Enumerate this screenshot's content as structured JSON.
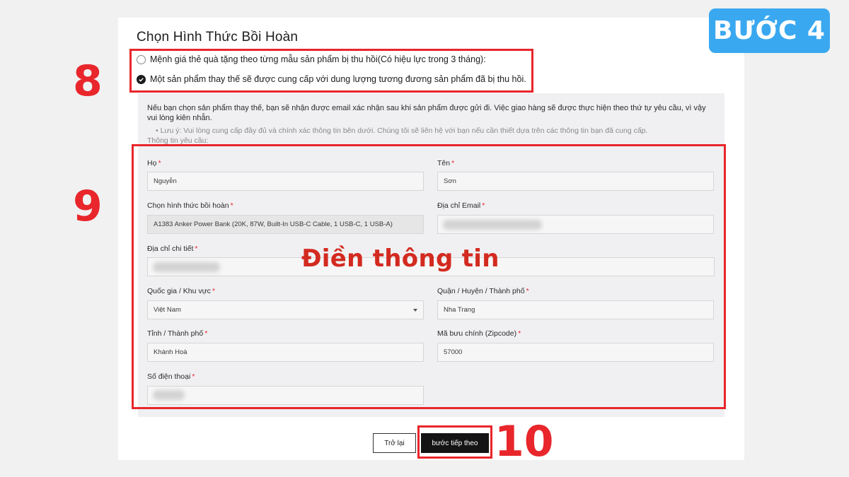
{
  "step_badge": "BƯỚC 4",
  "annotations": {
    "num8": "8",
    "num9": "9",
    "num10": "10",
    "overlay": "Điền thông tin"
  },
  "section_title": "Chọn Hình Thức Bồi Hoàn",
  "options": [
    {
      "label": "Mệnh giá thẻ quà tặng theo từng mẫu sản phẩm bị thu hồi(Có hiệu lực trong 3 tháng):",
      "selected": false
    },
    {
      "label": "Một sản phẩm thay thế sẽ được cung cấp với dung lượng tương đương sản phẩm đã bị thu hồi.",
      "selected": true
    }
  ],
  "info": {
    "line1": "Nếu bạn chọn sản phẩm thay thế, bạn sẽ nhận được email xác nhận sau khi sản phẩm được gửi đi. Việc giao hàng sẽ được thực hiện theo thứ tự yêu cầu, vì vậy",
    "line2": "vui lòng kiên nhẫn.",
    "note": "•  Lưu ý: Vui lòng cung cấp đầy đủ và chính xác thông tin bên dưới. Chúng tôi sẽ liên hệ với bạn nếu cần thiết dựa trên các thông tin bạn đã cung cấp.",
    "subheading": "Thông tin yêu cầu:"
  },
  "form": {
    "ho": {
      "label": "Họ",
      "value": "Nguyễn"
    },
    "ten": {
      "label": "Tên",
      "value": "Sơn"
    },
    "hinh_thuc": {
      "label": "Chọn hình thức bồi hoàn",
      "value": "A1383 Anker Power Bank (20K, 87W, Built-In USB-C Cable, 1 USB-C, 1 USB-A)"
    },
    "email": {
      "label": "Địa chỉ Email",
      "value": ""
    },
    "dia_chi": {
      "label": "Địa chỉ chi tiết",
      "value": ""
    },
    "quoc_gia": {
      "label": "Quốc gia / Khu vực",
      "value": "Việt Nam"
    },
    "quan": {
      "label": "Quận / Huyện / Thành phố",
      "value": "Nha Trang"
    },
    "tinh": {
      "label": "Tỉnh / Thành phố",
      "value": "Khánh Hoà"
    },
    "zip": {
      "label": "Mã bưu chính (Zipcode)",
      "value": "57000"
    },
    "phone": {
      "label": "Số điện thoại",
      "value": ""
    }
  },
  "buttons": {
    "back": "Trở lại",
    "next": "bước tiếp theo"
  },
  "colors": {
    "accent_red": "#e8262b",
    "badge_blue": "#3aa8f0",
    "button_dark": "#141414"
  }
}
